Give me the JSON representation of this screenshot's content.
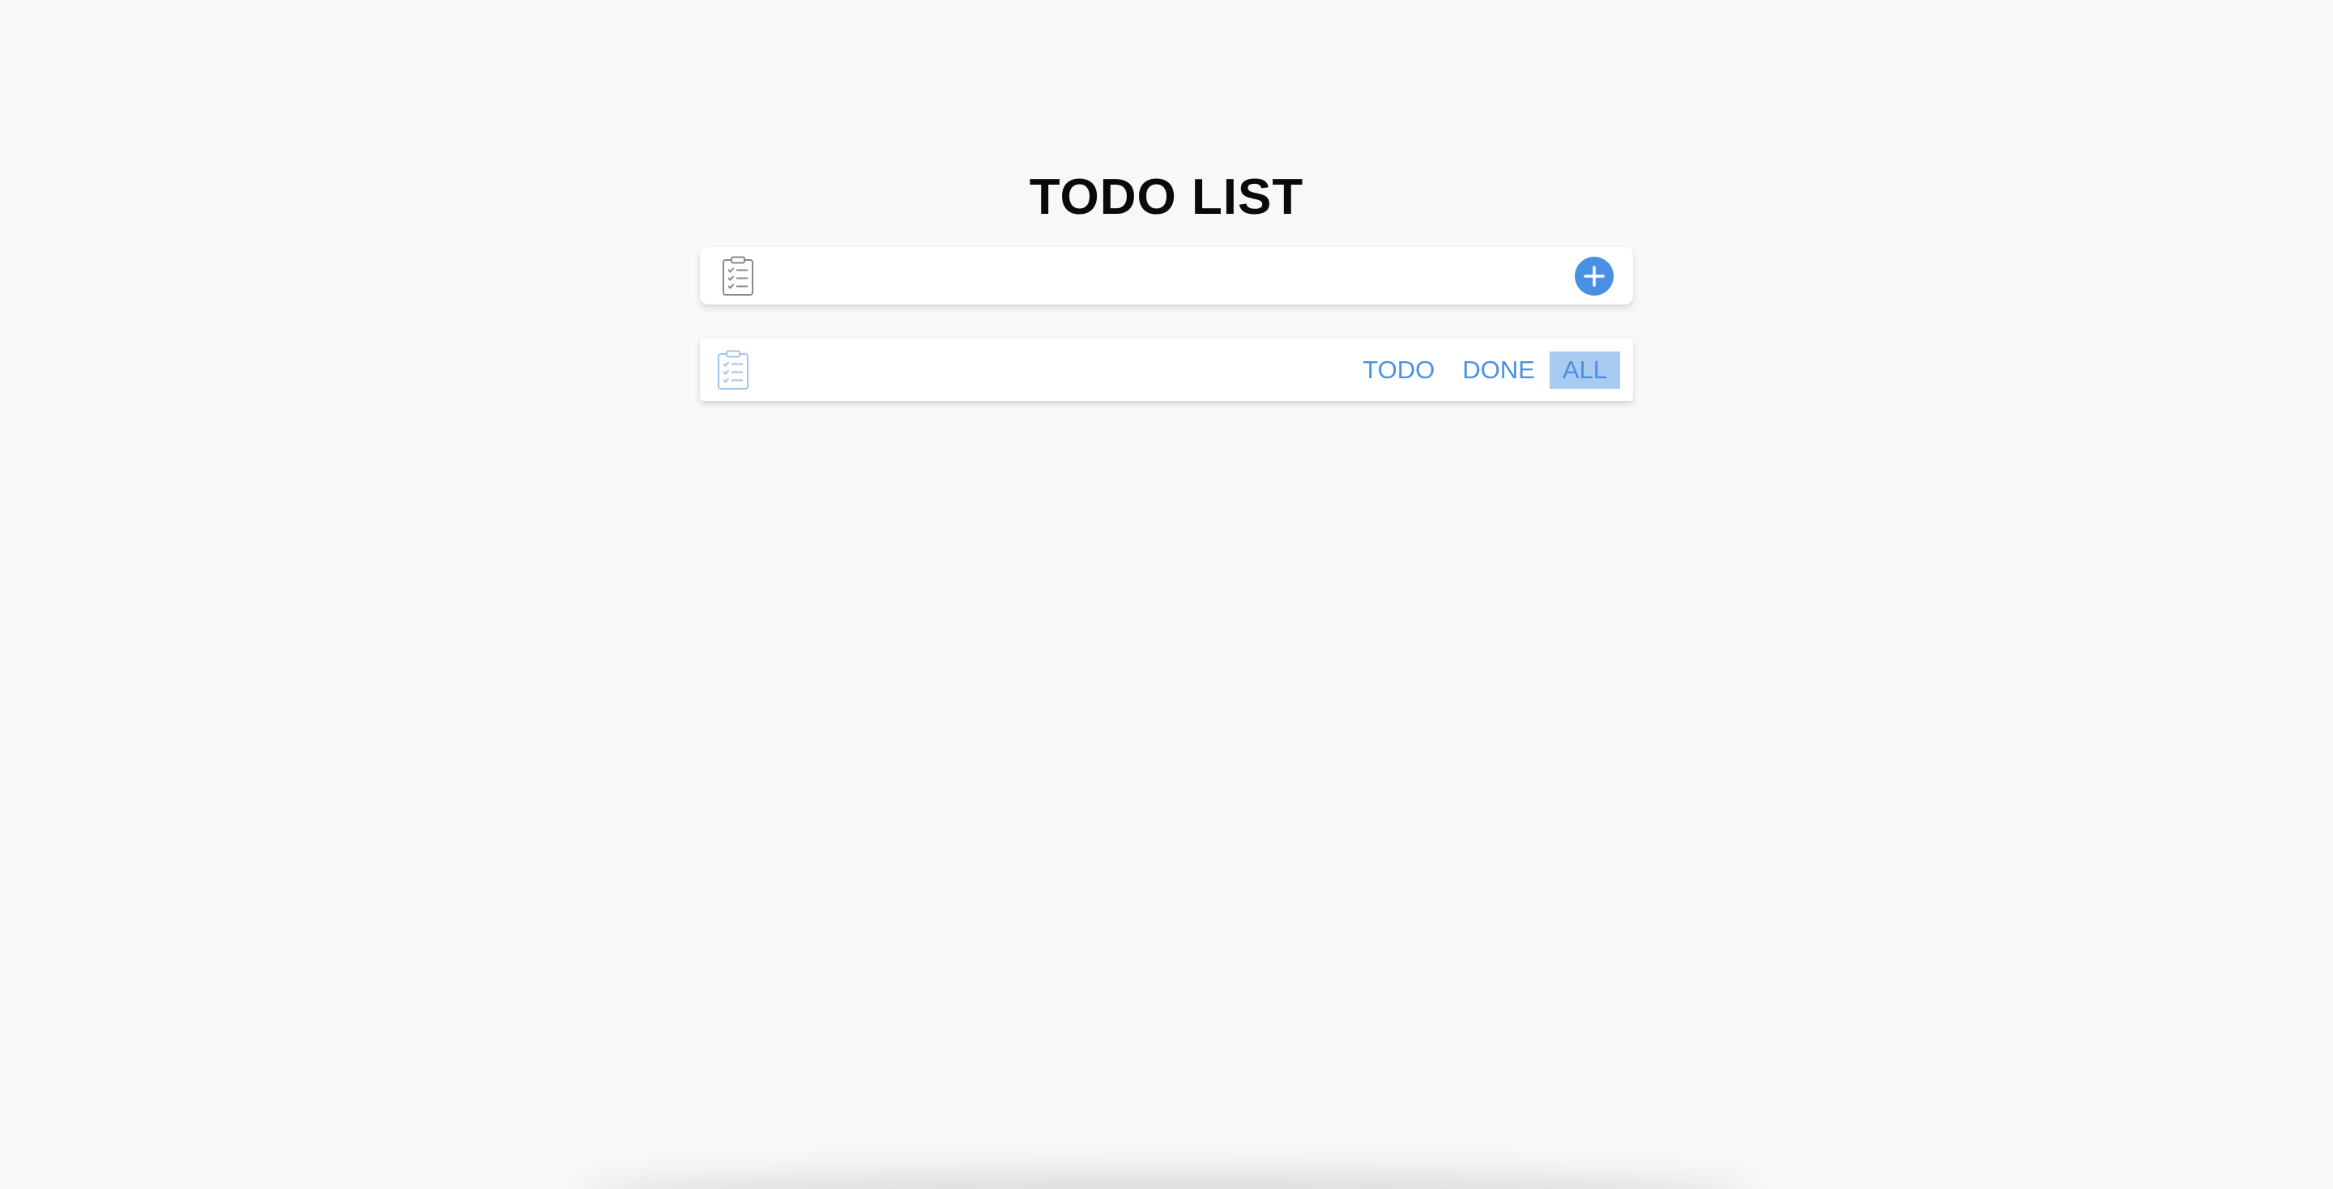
{
  "header": {
    "title": "TODO LIST"
  },
  "input": {
    "value": "",
    "placeholder": "",
    "icon": "clipboard-list-icon",
    "add_icon": "plus-circle-icon"
  },
  "filters": {
    "icon": "clipboard-list-icon",
    "items": [
      {
        "label": "TODO",
        "active": false
      },
      {
        "label": "DONE",
        "active": false
      },
      {
        "label": "ALL",
        "active": true
      }
    ]
  },
  "colors": {
    "accent": "#4a90e2",
    "active_filter_bg": "#a9cbf1",
    "background": "#f6f8fa",
    "card": "#ffffff",
    "title": "#0a0a0a",
    "input_icon": "#8a8a8a",
    "filter_icon": "#9fc4ee"
  }
}
